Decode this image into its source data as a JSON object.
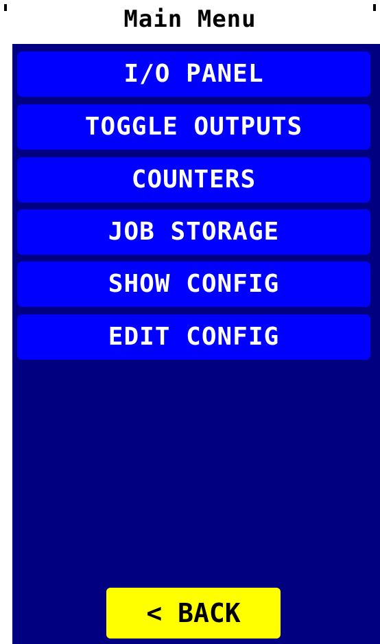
{
  "header": {
    "title": "Main Menu"
  },
  "menu": {
    "items": [
      {
        "label": "I/O PANEL"
      },
      {
        "label": "TOGGLE OUTPUTS"
      },
      {
        "label": "COUNTERS"
      },
      {
        "label": "JOB STORAGE"
      },
      {
        "label": "SHOW CONFIG"
      },
      {
        "label": "EDIT CONFIG"
      }
    ]
  },
  "footer": {
    "back_label": "< BACK"
  },
  "colors": {
    "screen_background": "#000080",
    "menu_button": "#0000ff",
    "menu_text": "#ffffff",
    "back_button": "#ffff00",
    "back_text": "#000000"
  }
}
